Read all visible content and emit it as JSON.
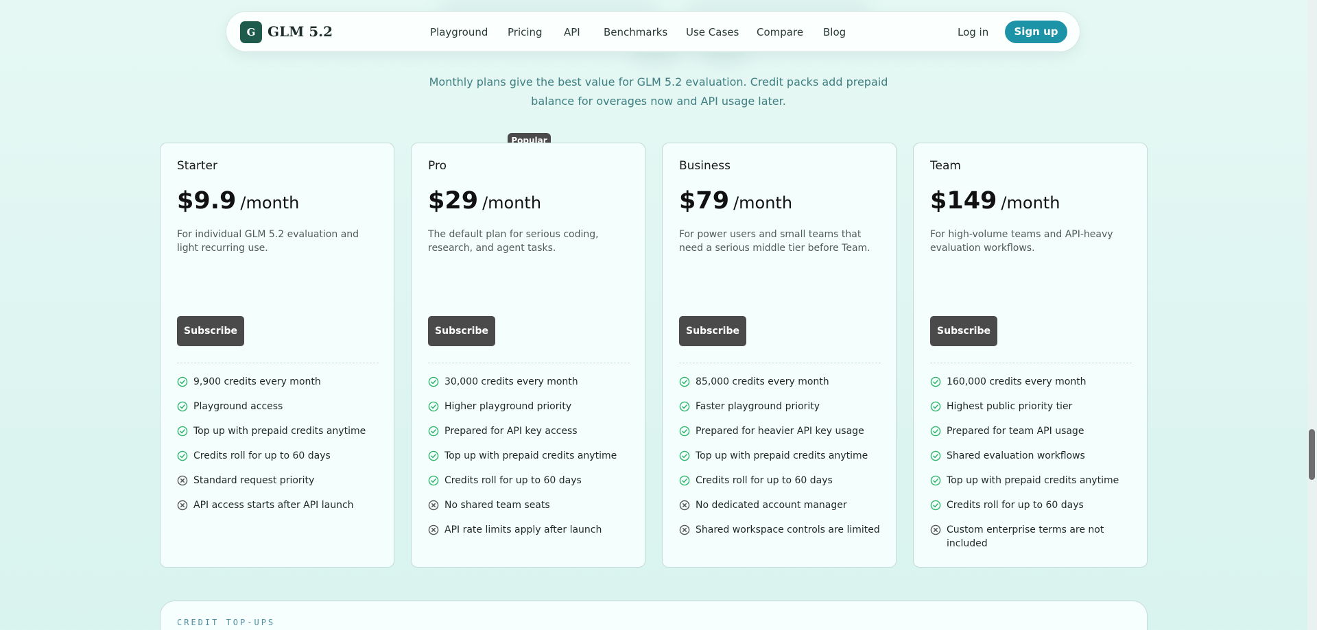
{
  "header": {
    "logo_mark": "G",
    "brand": "GLM 5.2",
    "nav": [
      "Playground",
      "Pricing",
      "API",
      "Benchmarks",
      "Use Cases",
      "Compare",
      "Blog"
    ],
    "login_label": "Log in",
    "signup_label": "Sign up"
  },
  "intro": {
    "line1": "Monthly plans give the best value for GLM 5.2 evaluation. Credit packs add prepaid",
    "line2": "balance for overages now and API usage later."
  },
  "plans": [
    {
      "name": "Starter",
      "price": "$9.9",
      "period": "/month",
      "description": "For individual GLM 5.2 evaluation and light recurring use.",
      "cta": "Subscribe",
      "features": [
        {
          "text": "9,900 credits every month",
          "included": true
        },
        {
          "text": "Playground access",
          "included": true
        },
        {
          "text": "Top up with prepaid credits anytime",
          "included": true
        },
        {
          "text": "Credits roll for up to 60 days",
          "included": true
        },
        {
          "text": "Standard request priority",
          "included": false
        },
        {
          "text": "API access starts after API launch",
          "included": false
        }
      ]
    },
    {
      "name": "Pro",
      "badge": "Popular",
      "price": "$29",
      "period": "/month",
      "description": "The default plan for serious coding, research, and agent tasks.",
      "cta": "Subscribe",
      "features": [
        {
          "text": "30,000 credits every month",
          "included": true
        },
        {
          "text": "Higher playground priority",
          "included": true
        },
        {
          "text": "Prepared for API key access",
          "included": true
        },
        {
          "text": "Top up with prepaid credits anytime",
          "included": true
        },
        {
          "text": "Credits roll for up to 60 days",
          "included": true
        },
        {
          "text": "No shared team seats",
          "included": false
        },
        {
          "text": "API rate limits apply after launch",
          "included": false
        }
      ]
    },
    {
      "name": "Business",
      "price": "$79",
      "period": "/month",
      "description": "For power users and small teams that need a serious middle tier before Team.",
      "cta": "Subscribe",
      "features": [
        {
          "text": "85,000 credits every month",
          "included": true
        },
        {
          "text": "Faster playground priority",
          "included": true
        },
        {
          "text": "Prepared for heavier API key usage",
          "included": true
        },
        {
          "text": "Top up with prepaid credits anytime",
          "included": true
        },
        {
          "text": "Credits roll for up to 60 days",
          "included": true
        },
        {
          "text": "No dedicated account manager",
          "included": false
        },
        {
          "text": "Shared workspace controls are limited",
          "included": false
        }
      ]
    },
    {
      "name": "Team",
      "price": "$149",
      "period": "/month",
      "description": "For high-volume teams and API-heavy evaluation workflows.",
      "cta": "Subscribe",
      "features": [
        {
          "text": "160,000 credits every month",
          "included": true
        },
        {
          "text": "Highest public priority tier",
          "included": true
        },
        {
          "text": "Prepared for team API usage",
          "included": true
        },
        {
          "text": "Shared evaluation workflows",
          "included": true
        },
        {
          "text": "Top up with prepaid credits anytime",
          "included": true
        },
        {
          "text": "Credits roll for up to 60 days",
          "included": true
        },
        {
          "text": "Custom enterprise terms are not included",
          "included": false
        }
      ]
    }
  ],
  "credit_section": {
    "label": "CREDIT TOP-UPS"
  },
  "icons": {
    "included": "check-circle-icon",
    "excluded": "x-circle-icon"
  },
  "colors": {
    "accent": "#1d93a8",
    "brand": "#1e5b4d",
    "check": "#2fb36b",
    "button": "#4a4a4a",
    "background": "#def5f1"
  }
}
